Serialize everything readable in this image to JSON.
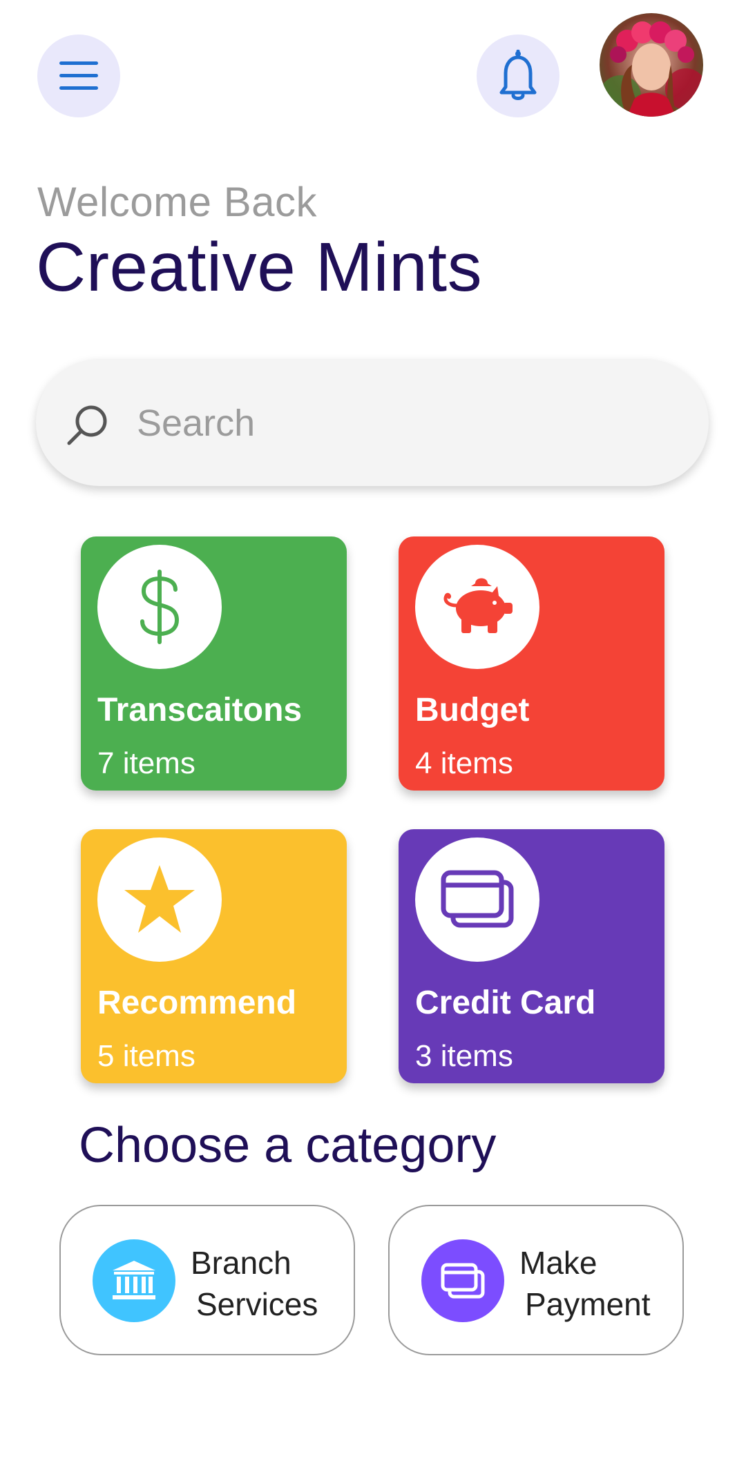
{
  "header": {
    "menu_icon": "hamburger-menu-icon",
    "notification_icon": "bell-icon",
    "avatar_alt": "avatar"
  },
  "greeting": {
    "welcome": "Welcome Back",
    "name": "Creative Mints"
  },
  "search": {
    "placeholder": "Search",
    "value": "",
    "icon": "search-icon"
  },
  "tiles": [
    {
      "title": "Transcaitons",
      "count": "7 items",
      "icon": "dollar-icon",
      "color": "#4caf50"
    },
    {
      "title": "Budget",
      "count": "4 items",
      "icon": "piggy-bank-icon",
      "color": "#f44336"
    },
    {
      "title": "Recommend",
      "count": "5 items",
      "icon": "star-icon",
      "color": "#fbc02d"
    },
    {
      "title": "Credit Card",
      "count": "3 items",
      "icon": "credit-card-icon",
      "color": "#673ab7"
    }
  ],
  "category": {
    "title": "Choose a category",
    "cards": [
      {
        "line1": "Branch",
        "line2": "Services",
        "icon": "bank-icon",
        "color": "#40c4ff"
      },
      {
        "line1": "Make",
        "line2": "Payment",
        "icon": "card-icon",
        "color": "#7c4dff"
      }
    ]
  }
}
